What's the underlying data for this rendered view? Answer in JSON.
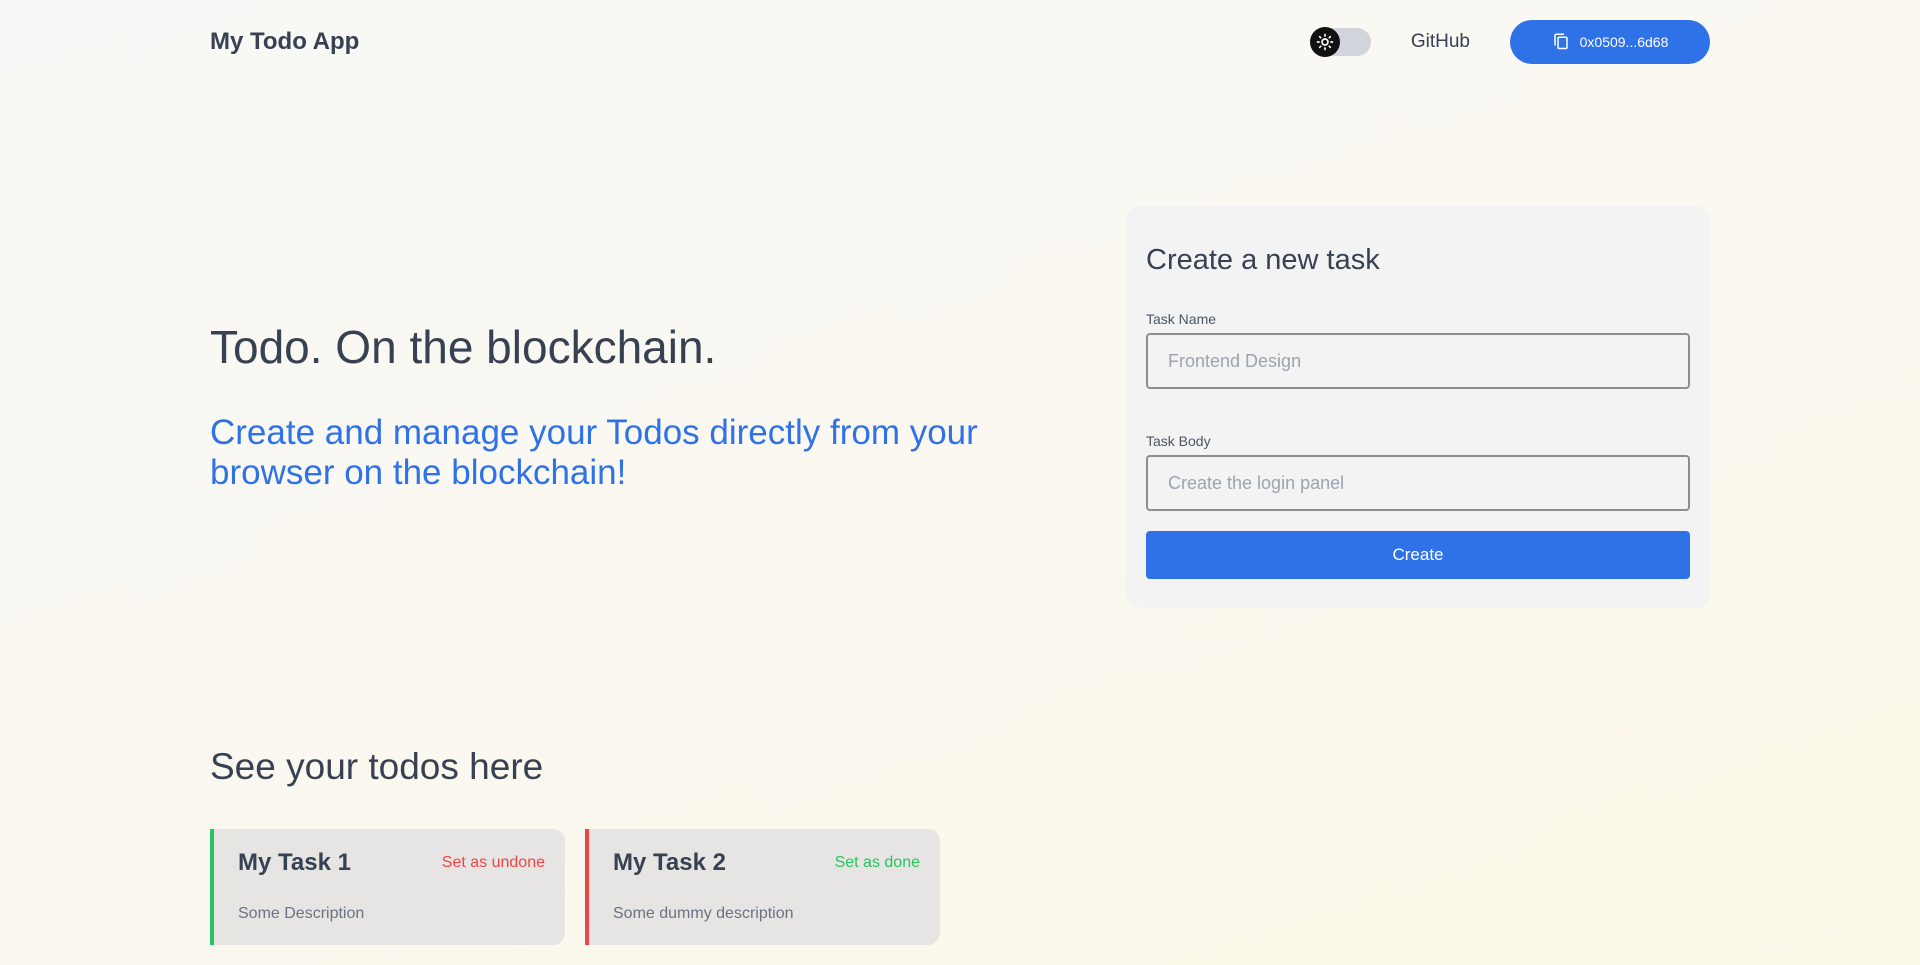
{
  "header": {
    "brand": "My Todo App",
    "github_label": "GitHub",
    "wallet_address": "0x0509...6d68",
    "theme_toggle_state": "light"
  },
  "hero": {
    "title": "Todo. On the blockchain.",
    "subtitle": "Create and manage your Todos directly from your browser on the blockchain!"
  },
  "form": {
    "title": "Create a new task",
    "task_name_label": "Task Name",
    "task_name_placeholder": "Frontend Design",
    "task_name_value": "",
    "task_body_label": "Task Body",
    "task_body_placeholder": "Create the login panel",
    "task_body_value": "",
    "submit_label": "Create"
  },
  "todos": {
    "title": "See your todos here",
    "items": [
      {
        "name": "My Task 1",
        "description": "Some Description",
        "action_label": "Set as undone",
        "status": "done",
        "action_color": "#ef4444",
        "border_color": "#22c55e"
      },
      {
        "name": "My Task 2",
        "description": "Some dummy description",
        "action_label": "Set as done",
        "status": "undone",
        "action_color": "#22c55e",
        "border_color": "#ef4444"
      }
    ]
  },
  "colors": {
    "accent": "#2f72e8",
    "text": "#374151",
    "success": "#22c55e",
    "danger": "#ef4444"
  },
  "icons": {
    "theme_toggle": "sun-icon",
    "wallet_button": "copy-icon"
  }
}
